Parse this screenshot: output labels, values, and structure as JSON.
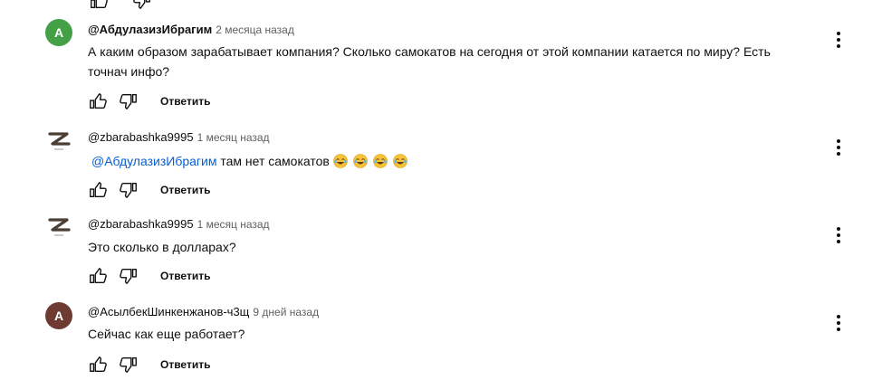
{
  "comments": [
    {
      "avatar_letter": "A",
      "avatar_color": "#43a047",
      "author": "@АбдулазизИбрагим",
      "time": "2 месяца назад",
      "text": "А каким образом зарабатывает компания? Сколько самокатов на сегодня от этой компании катается по миру? Есть точнач инфо?",
      "reply_label": "Ответить"
    },
    {
      "avatar_letter": "Z",
      "author": "@zbarabashka9995",
      "time": "1 месяц назад",
      "mention": "@АбдулазизИбрагим",
      "text": "там нет самокатов",
      "emoji_count": 4,
      "reply_label": "Ответить"
    },
    {
      "avatar_letter": "Z",
      "author": "@zbarabashka9995",
      "time": "1 месяц назад",
      "text": "Это сколько в долларах?",
      "reply_label": "Ответить"
    },
    {
      "avatar_letter": "A",
      "avatar_color": "#6d3b32",
      "author": "@АсылбекШинкенжанов-ч3щ",
      "time": "9 дней назад",
      "text": "Сейчас как еще работает?",
      "reply_label": "Ответить"
    }
  ],
  "icons": {
    "like": "thumb-up-icon",
    "dislike": "thumb-down-icon",
    "more": "more-vert-icon",
    "emoji": "joy-emoji"
  },
  "colors": {
    "mention": "#065fd4",
    "meta": "#606060"
  }
}
